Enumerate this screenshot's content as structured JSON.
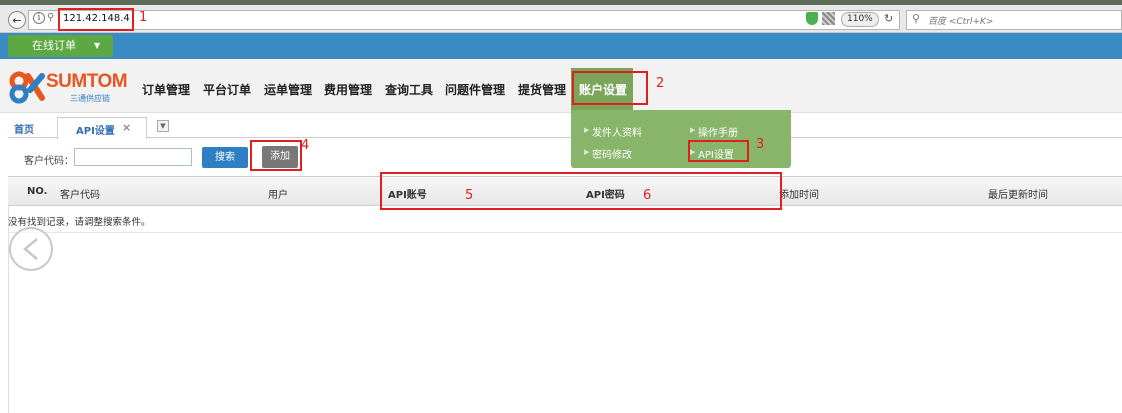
{
  "browser": {
    "url": "121.42.148.4",
    "zoom": "110%",
    "search_placeholder": "百度 <Ctrl+K>"
  },
  "toolbar": {
    "online_order_label": "在线订单",
    "online_order_caret": "▼"
  },
  "logo": {
    "brand": "SUMTOM",
    "sub": "三通供应链"
  },
  "nav": {
    "items": [
      "订单管理",
      "平台订单",
      "运单管理",
      "费用管理",
      "查询工具",
      "问题件管理",
      "提货管理"
    ],
    "active": "账户设置"
  },
  "dropdown": {
    "items": [
      "发件人资料",
      "操作手册",
      "密码修改",
      "API设置"
    ]
  },
  "tabs": {
    "home": "首页",
    "active": "API设置",
    "close": "×",
    "menu": "▼"
  },
  "filter": {
    "label": "客户代码：",
    "value": "",
    "search_label": "搜索",
    "add_label": "添加"
  },
  "table": {
    "columns": [
      "NO.",
      "客户代码",
      "用户",
      "API账号",
      "API密码",
      "添加时间",
      "最后更新时间"
    ],
    "empty_message": "没有找到记录，请调整搜索条件。"
  },
  "annotations": [
    "1",
    "2",
    "3",
    "4",
    "5",
    "6"
  ],
  "colors": {
    "blue_band": "#3a8bc3",
    "green_menu": "#88b56a",
    "annotation_red": "#e02020",
    "search_button": "#2f7fc4"
  }
}
